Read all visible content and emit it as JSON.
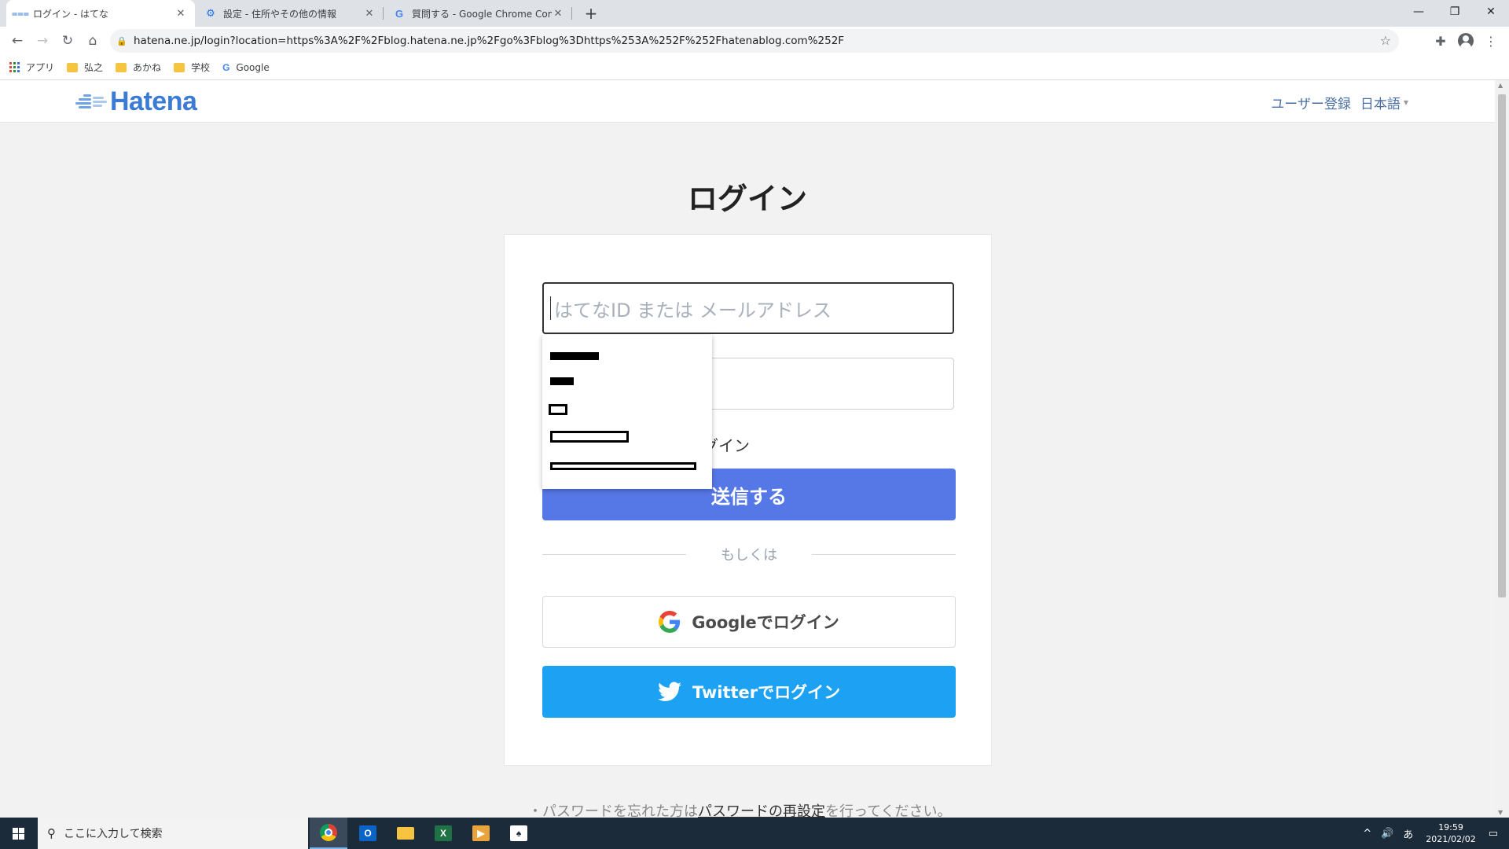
{
  "browser": {
    "tabs": [
      {
        "title": "ログイン - はてな",
        "active": true
      },
      {
        "title": "設定 - 住所やその他の情報",
        "active": false
      },
      {
        "title": "質問する - Google Chrome Comm",
        "active": false
      }
    ],
    "url": "hatena.ne.jp/login?location=https%3A%2F%2Fblog.hatena.ne.jp%2Fgo%3Fblog%3Dhttps%253A%252F%252Fhatenablog.com%252F",
    "bookmarks": [
      {
        "label": "アプリ",
        "icon": "apps-grid-icon"
      },
      {
        "label": "弘之",
        "icon": "folder-icon"
      },
      {
        "label": "あかね",
        "icon": "folder-icon"
      },
      {
        "label": "学校",
        "icon": "folder-icon"
      },
      {
        "label": "Google",
        "icon": "google-icon"
      }
    ]
  },
  "header": {
    "logo_text": "Hatena",
    "register_link": "ユーザー登録",
    "language": "日本語"
  },
  "login": {
    "title": "ログイン",
    "id_placeholder": "はてなID または メールアドレス",
    "password_placeholder": "",
    "remember_label": "グイン",
    "submit_label": "送信する",
    "divider_text": "もしくは",
    "google_label": "Googleでログイン",
    "twitter_label": "Twitterでログイン",
    "forgot_prefix": "・パスワードを忘れた方は",
    "forgot_link": "パスワードの再設定",
    "forgot_suffix": "を行ってください。"
  },
  "taskbar": {
    "search_placeholder": "ここに入力して検索",
    "apps": [
      "chrome-icon",
      "outlook-icon",
      "file-explorer-icon",
      "excel-icon",
      "media-player-icon",
      "solitaire-icon"
    ],
    "ime": "あ",
    "time": "19:59",
    "date": "2021/02/02"
  },
  "colors": {
    "submit": "#5578e6",
    "twitter": "#1da1f2",
    "logo": "#3a7bd5"
  }
}
